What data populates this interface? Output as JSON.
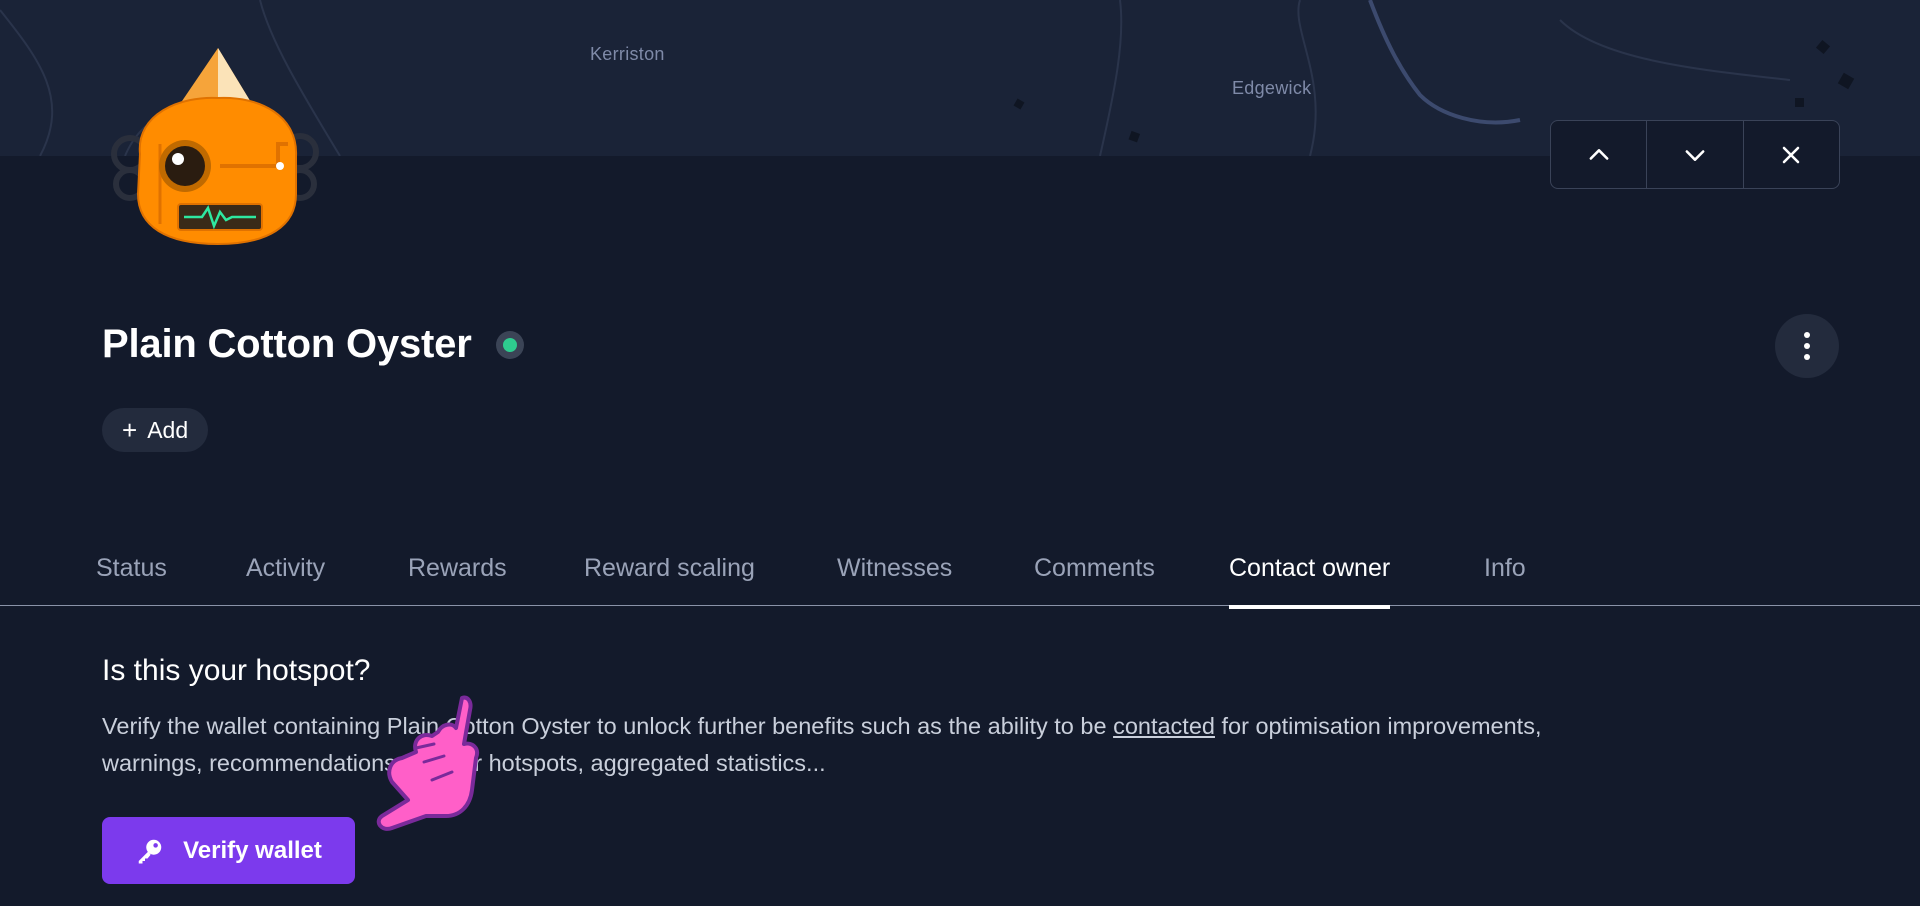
{
  "map": {
    "labels": [
      "Kerriston",
      "Edgewick"
    ]
  },
  "hotspot": {
    "name": "Plain Cotton Oyster",
    "status": "online",
    "status_color": "#2ecc8f",
    "avatar_icon": "robot-avatar-icon"
  },
  "nav": {
    "up_icon": "chevron-up-icon",
    "down_icon": "chevron-down-icon",
    "close_icon": "close-icon"
  },
  "actions": {
    "add_label": "Add",
    "more_icon": "vertical-dots-icon"
  },
  "tabs": [
    {
      "label": "Status",
      "active": false
    },
    {
      "label": "Activity",
      "active": false
    },
    {
      "label": "Rewards",
      "active": false
    },
    {
      "label": "Reward scaling",
      "active": false
    },
    {
      "label": "Witnesses",
      "active": false
    },
    {
      "label": "Comments",
      "active": false
    },
    {
      "label": "Contact owner",
      "active": true
    },
    {
      "label": "Info",
      "active": false
    }
  ],
  "contact": {
    "heading": "Is this your hotspot?",
    "text_before": "Verify the wallet containing Plain Cotton Oyster to unlock further benefits such as the ability to be ",
    "link": "contacted",
    "text_after": " for optimisation improvements, warnings, recommendations for your hotspots, aggregated statistics...",
    "verify_label": "Verify wallet",
    "verify_icon": "key-icon",
    "accent": "#7c3aed"
  },
  "overlay": {
    "pointer_icon": "pointing-hand-icon",
    "pointer_color": "#ff5fc8"
  }
}
